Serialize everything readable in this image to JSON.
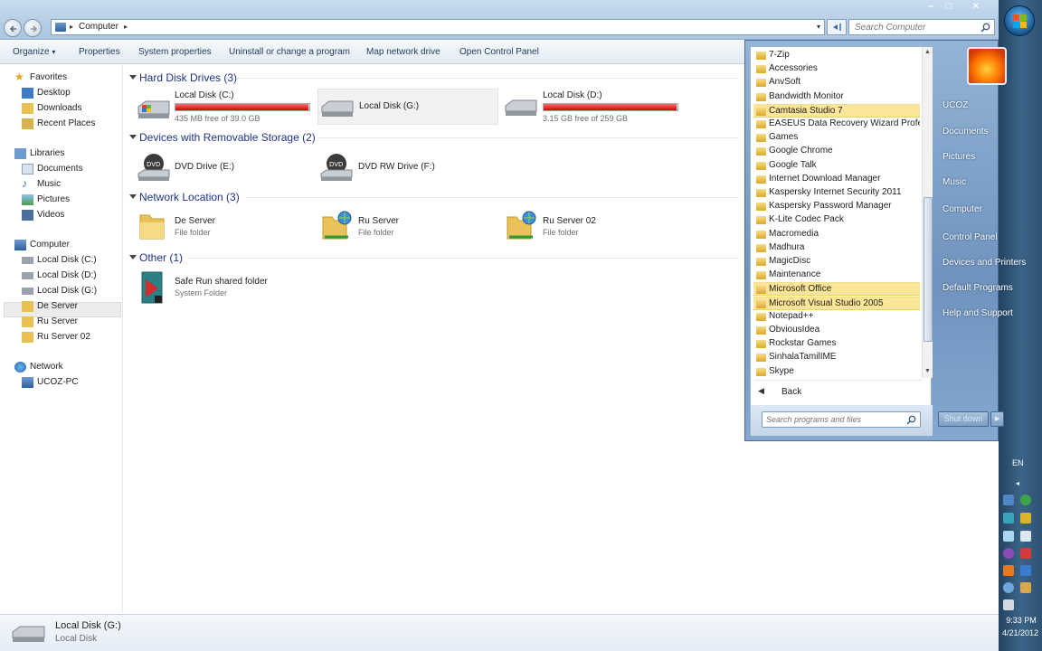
{
  "address": {
    "path": "Computer"
  },
  "search": {
    "placeholder": "Search Computer"
  },
  "toolbar": {
    "organize": "Organize",
    "properties": "Properties",
    "system_properties": "System properties",
    "uninstall": "Uninstall or change a program",
    "map_drive": "Map network drive",
    "control_panel": "Open Control Panel"
  },
  "nav": {
    "favorites": "Favorites",
    "desktop": "Desktop",
    "downloads": "Downloads",
    "recent": "Recent Places",
    "libraries": "Libraries",
    "documents": "Documents",
    "music": "Music",
    "pictures": "Pictures",
    "videos": "Videos",
    "computer": "Computer",
    "disk_c": "Local Disk (C:)",
    "disk_d": "Local Disk (D:)",
    "disk_g": "Local Disk (G:)",
    "de_server": "De Server",
    "ru_server": "Ru Server",
    "ru_server_02": "Ru Server 02",
    "network": "Network",
    "ucoz_pc": "UCOZ-PC"
  },
  "groups": {
    "hdd": "Hard Disk Drives (3)",
    "removable": "Devices with Removable Storage (2)",
    "network": "Network Location (3)",
    "other": "Other (1)"
  },
  "drives": {
    "c": {
      "name": "Local Disk (C:)",
      "free": "435 MB free of 39.0 GB",
      "used_fraction": 0.99
    },
    "g": {
      "name": "Local Disk (G:)"
    },
    "d": {
      "name": "Local Disk (D:)",
      "free": "3.15 GB free of 259 GB",
      "used_fraction": 0.99
    }
  },
  "removable": {
    "e": {
      "name": "DVD Drive (E:)"
    },
    "f": {
      "name": "DVD RW Drive (F:)"
    }
  },
  "netloc": {
    "de": {
      "name": "De Server",
      "type": "File folder"
    },
    "ru": {
      "name": "Ru Server",
      "type": "File folder"
    },
    "ru02": {
      "name": "Ru Server 02",
      "type": "File folder"
    }
  },
  "other": {
    "safe": {
      "name": "Safe Run shared folder",
      "type": "System Folder"
    }
  },
  "details": {
    "name": "Local Disk (G:)",
    "type": "Local Disk"
  },
  "start_menu": {
    "programs": [
      {
        "name": "7-Zip",
        "highlight": false
      },
      {
        "name": "Accessories",
        "highlight": false
      },
      {
        "name": "AnvSoft",
        "highlight": false
      },
      {
        "name": "Bandwidth Monitor",
        "highlight": false
      },
      {
        "name": "Camtasia Studio 7",
        "highlight": true
      },
      {
        "name": "EASEUS Data Recovery Wizard Professio",
        "highlight": false
      },
      {
        "name": "Games",
        "highlight": false
      },
      {
        "name": "Google Chrome",
        "highlight": false
      },
      {
        "name": "Google Talk",
        "highlight": false
      },
      {
        "name": "Internet Download Manager",
        "highlight": false
      },
      {
        "name": "Kaspersky Internet Security 2011",
        "highlight": false
      },
      {
        "name": "Kaspersky Password Manager",
        "highlight": false
      },
      {
        "name": "K-Lite Codec Pack",
        "highlight": false
      },
      {
        "name": "Macromedia",
        "highlight": false
      },
      {
        "name": "Madhura",
        "highlight": false
      },
      {
        "name": "MagicDisc",
        "highlight": false
      },
      {
        "name": "Maintenance",
        "highlight": false
      },
      {
        "name": "Microsoft Office",
        "highlight": true
      },
      {
        "name": "Microsoft Visual Studio 2005",
        "highlight": true
      },
      {
        "name": "Notepad++",
        "highlight": false
      },
      {
        "name": "ObviousIdea",
        "highlight": false
      },
      {
        "name": "Rockstar Games",
        "highlight": false
      },
      {
        "name": "SinhalaTamilIME",
        "highlight": false
      },
      {
        "name": "Skype",
        "highlight": false
      }
    ],
    "back": "Back",
    "search_placeholder": "Search programs and files",
    "right": [
      "UCOZ",
      "Documents",
      "Pictures",
      "Music",
      "Computer",
      "Control Panel",
      "Devices and Printers",
      "Default Programs",
      "Help and Support"
    ],
    "shutdown": "Shut down"
  },
  "taskbar": {
    "lang": "EN",
    "time": "9:33 PM",
    "date": "4/21/2012"
  },
  "colors": {
    "accent": "#1e3287",
    "bar_fill": "#d20000",
    "highlight": "#fbe599"
  }
}
